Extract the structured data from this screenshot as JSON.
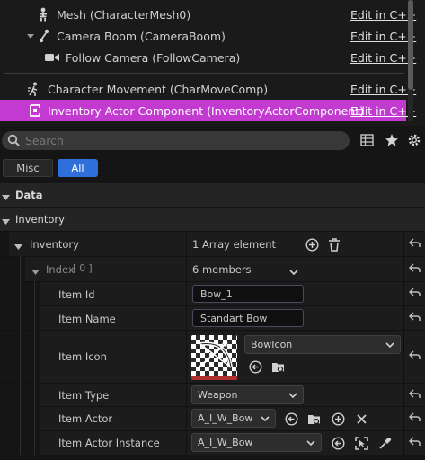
{
  "components": [
    {
      "label": "Mesh (CharacterMesh0)",
      "edit": "Edit in C++"
    },
    {
      "label": "Camera Boom (CameraBoom)",
      "edit": "Edit in C++"
    },
    {
      "label": "Follow Camera (FollowCamera)",
      "edit": "Edit in C++"
    },
    {
      "label": "Character Movement (CharMoveComp)",
      "edit": "Edit in C++"
    },
    {
      "label": "Inventory Actor Component (InventoryActorComponent)",
      "edit": "Edit in C++",
      "selected": true
    }
  ],
  "search": {
    "placeholder": "Search"
  },
  "filter_tabs": [
    {
      "label": "Misc",
      "active": false
    },
    {
      "label": "All",
      "active": true
    }
  ],
  "categories": {
    "data": "Data",
    "inventory": "Inventory"
  },
  "inventory_array": {
    "label": "Inventory",
    "value": "1 Array element"
  },
  "index_struct": {
    "label": "Index",
    "index": "[ 0 ]",
    "value": "6 members"
  },
  "properties": {
    "item_id": {
      "label": "Item Id",
      "value": "Bow_1"
    },
    "item_name": {
      "label": "Item Name",
      "value": "Standart Bow"
    },
    "item_icon": {
      "label": "Item Icon",
      "value": "BowIcon"
    },
    "item_type": {
      "label": "Item Type",
      "value": "Weapon"
    },
    "item_actor": {
      "label": "Item Actor",
      "value": "A_I_W_Bow"
    },
    "item_actor_instance": {
      "label": "Item Actor Instance",
      "value": "A_I_W_Bow"
    }
  },
  "colors": {
    "selection": "#c33ad0",
    "accent": "#2f6fdc"
  }
}
